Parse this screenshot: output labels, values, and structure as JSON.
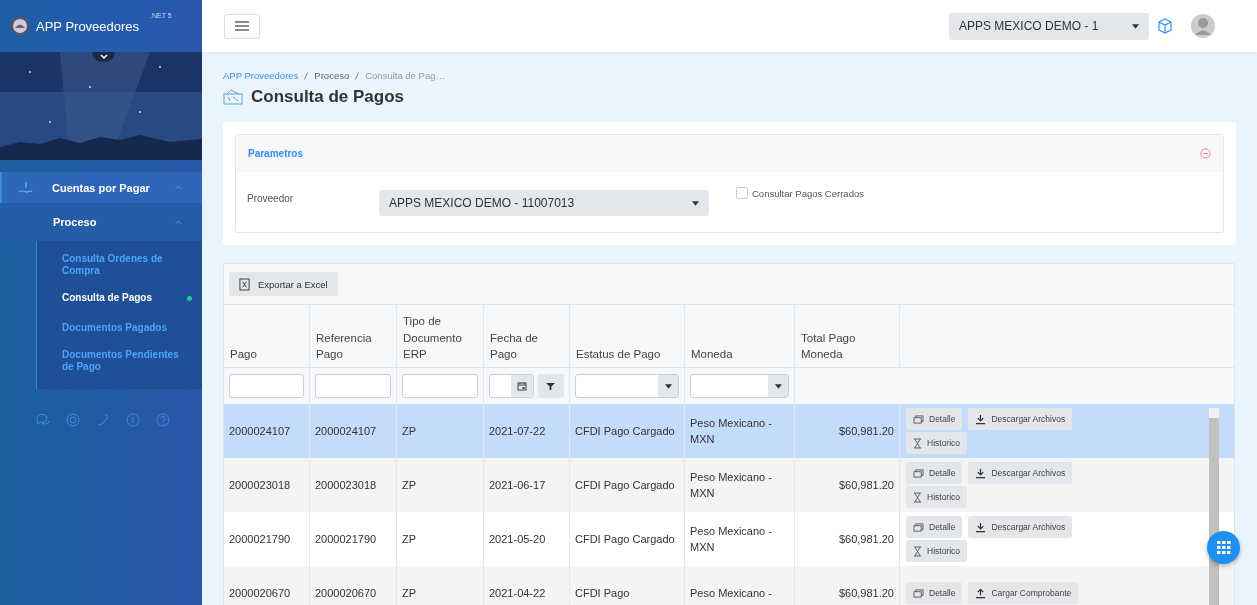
{
  "app": {
    "title": "APP Proveedores",
    "badge": ".NET 5"
  },
  "sidebar": {
    "menu": [
      {
        "label": "Cuentas por Pagar",
        "expanded": true,
        "children": [
          {
            "label": "Proceso",
            "expanded": true,
            "children": [
              {
                "label": "Consulta Ordenes de Compra",
                "selected": false
              },
              {
                "label": "Consulta de Pagos",
                "selected": true
              },
              {
                "label": "Documentos Pagados",
                "selected": false
              },
              {
                "label": "Documentos Pendientes de Pago",
                "selected": false
              }
            ]
          }
        ]
      }
    ]
  },
  "topbar": {
    "company": "APPS MEXICO DEMO - 1"
  },
  "breadcrumb": [
    "APP Proveedores",
    "Proceso",
    "Consulta de Pag…"
  ],
  "page_title": "Consulta de Pagos",
  "parameters": {
    "title": "Parametros",
    "proveedor_label": "Proveedor",
    "proveedor_value": "APPS MEXICO DEMO - 11007013",
    "closed_checkbox": {
      "label": "Consultar Pagos Cerrados",
      "checked": false
    }
  },
  "table": {
    "export_button": "Exportar a Excel",
    "columns": [
      {
        "label": "Pago",
        "kind": "text"
      },
      {
        "label": "Referencia Pago",
        "kind": "text"
      },
      {
        "label": "Tipo de Documento ERP",
        "kind": "text"
      },
      {
        "label": "Fecha de Pago",
        "kind": "date"
      },
      {
        "label": "Estatus de Pago",
        "kind": "select"
      },
      {
        "label": "Moneda",
        "kind": "select"
      },
      {
        "label": "Total Pago Moneda",
        "kind": "none"
      }
    ],
    "rows": [
      {
        "selected": true,
        "cells": [
          "2000024107",
          "2000024107",
          "ZP",
          "2021-07-22",
          "CFDI Pago Cargado",
          "Peso Mexicano - MXN",
          "$60,981.20"
        ],
        "actions": [
          {
            "label": "Detalle",
            "kind": "detail"
          },
          {
            "label": "Descargar Archivos",
            "kind": "download"
          },
          {
            "label": "Historico",
            "kind": "history"
          }
        ]
      },
      {
        "selected": false,
        "cells": [
          "2000023018",
          "2000023018",
          "ZP",
          "2021-06-17",
          "CFDI Pago Cargado",
          "Peso Mexicano - MXN",
          "$60,981.20"
        ],
        "actions": [
          {
            "label": "Detalle",
            "kind": "detail"
          },
          {
            "label": "Descargar Archivos",
            "kind": "download"
          },
          {
            "label": "Historico",
            "kind": "history"
          }
        ]
      },
      {
        "selected": false,
        "cells": [
          "2000021790",
          "2000021790",
          "ZP",
          "2021-05-20",
          "CFDI Pago Cargado",
          "Peso Mexicano - MXN",
          "$60,981.20"
        ],
        "actions": [
          {
            "label": "Detalle",
            "kind": "detail"
          },
          {
            "label": "Descargar Archivos",
            "kind": "download"
          },
          {
            "label": "Historico",
            "kind": "history"
          }
        ]
      },
      {
        "selected": false,
        "cells": [
          "2000020670",
          "2000020670",
          "ZP",
          "2021-04-22",
          "CFDI Pago",
          "Peso Mexicano -",
          "$60,981.20"
        ],
        "actions": [
          {
            "label": "Detalle",
            "kind": "detail"
          },
          {
            "label": "Cargar Comprobante",
            "kind": "upload"
          }
        ]
      }
    ]
  }
}
